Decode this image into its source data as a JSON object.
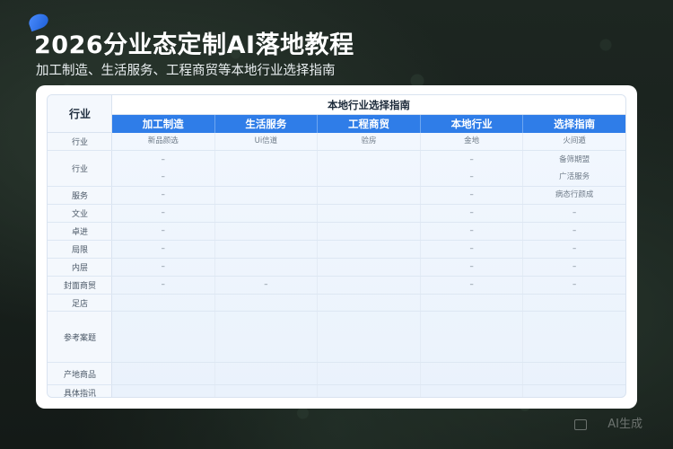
{
  "header": {
    "title": "2026分业态定制AI落地教程",
    "subtitle": "加工制造、生活服务、工程商贸等本地行业选择指南"
  },
  "table": {
    "corner_label": "行业",
    "title": "本地行业选择指南",
    "columns": [
      "加工制造",
      "生活服务",
      "工程商贸",
      "本地行业",
      "选择指南"
    ],
    "rows": [
      {
        "label": "行业",
        "cells": [
          [
            "新品颜选"
          ],
          [
            "Ui信道"
          ],
          [
            "验房"
          ],
          [
            "金地"
          ],
          [
            "火间遁"
          ]
        ]
      },
      {
        "label": "行业",
        "cells": [
          [
            "–",
            "–"
          ],
          [
            "",
            ""
          ],
          [
            "",
            ""
          ],
          [
            "–",
            "–"
          ],
          [
            "备筛期盟",
            "广活服务"
          ]
        ]
      },
      {
        "label": "服务",
        "cells": [
          [
            "–"
          ],
          [
            ""
          ],
          [
            ""
          ],
          [
            "–"
          ],
          [
            "病态行颜成"
          ]
        ]
      },
      {
        "label": "文业",
        "cells": [
          [
            "–"
          ],
          [
            ""
          ],
          [
            ""
          ],
          [
            "–"
          ],
          [
            "–"
          ]
        ]
      },
      {
        "label": "卓进",
        "cells": [
          [
            "–"
          ],
          [
            ""
          ],
          [
            ""
          ],
          [
            "–"
          ],
          [
            "–"
          ]
        ]
      },
      {
        "label": "局限",
        "cells": [
          [
            "–"
          ],
          [
            ""
          ],
          [
            ""
          ],
          [
            "–"
          ],
          [
            "–"
          ]
        ]
      },
      {
        "label": "内层",
        "cells": [
          [
            "–"
          ],
          [
            ""
          ],
          [
            ""
          ],
          [
            "–"
          ],
          [
            "–"
          ]
        ]
      },
      {
        "label": "封面商贸",
        "cells": [
          [
            "–"
          ],
          [
            "–"
          ],
          [
            ""
          ],
          [
            "–"
          ],
          [
            "–"
          ]
        ]
      },
      {
        "label": "足店",
        "cells": [
          [
            ""
          ],
          [
            ""
          ],
          [
            ""
          ],
          [
            ""
          ],
          [
            ""
          ]
        ]
      },
      {
        "label": "参考案题",
        "cells": [
          [
            ""
          ],
          [
            ""
          ],
          [
            ""
          ],
          [
            ""
          ],
          [
            ""
          ]
        ]
      },
      {
        "label": "产地商品",
        "cells": [
          [
            ""
          ],
          [
            ""
          ],
          [
            ""
          ],
          [
            ""
          ],
          [
            ""
          ]
        ]
      },
      {
        "label": "具体指讯",
        "cells": [
          [
            ""
          ],
          [
            ""
          ],
          [
            ""
          ],
          [
            ""
          ],
          [
            ""
          ]
        ]
      }
    ]
  },
  "watermark": "AI生成",
  "colors": {
    "accent": "#2f7de8",
    "card": "#ffffff",
    "background": "#1b231f"
  }
}
